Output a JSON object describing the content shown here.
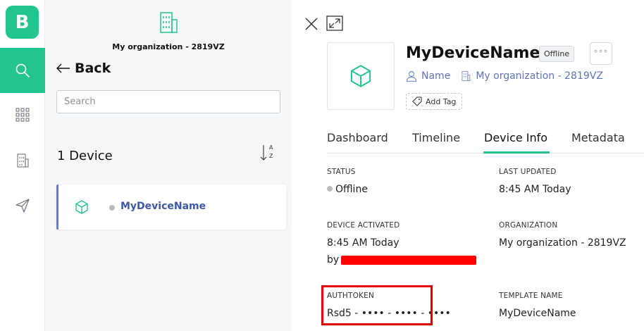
{
  "app": {
    "logo_letter": "B",
    "brand_color": "#23c48e"
  },
  "rail": {
    "items": [
      {
        "name": "search-icon",
        "active": true
      },
      {
        "name": "apps-grid-icon",
        "active": false
      },
      {
        "name": "building-icon",
        "active": false
      },
      {
        "name": "send-icon",
        "active": false
      }
    ]
  },
  "panel": {
    "org_name": "My organization - 2819VZ",
    "back_label": "Back",
    "search_placeholder": "Search",
    "device_count": "1 Device",
    "sort_label_top": "A",
    "sort_label_bottom": "Z",
    "devices": [
      {
        "name": "MyDeviceName",
        "status": "offline"
      }
    ]
  },
  "detail": {
    "title": "MyDeviceName",
    "status_badge": "Offline",
    "more_label": "°°°",
    "owner_label": "Name",
    "org_label": "My organization - 2819VZ",
    "add_tag_label": "Add Tag",
    "tabs": [
      "Dashboard",
      "Timeline",
      "Device Info",
      "Metadata"
    ],
    "active_tab": "Device Info",
    "fields": {
      "status_label": "STATUS",
      "status_value": "Offline",
      "last_updated_label": "LAST UPDATED",
      "last_updated_value": "8:45 AM Today",
      "device_activated_label": "DEVICE ACTIVATED",
      "device_activated_value": "8:45 AM Today",
      "device_activated_by": "by",
      "organization_label": "ORGANIZATION",
      "organization_value": "My organization - 2819VZ",
      "authtoken_label": "AUTHTOKEN",
      "authtoken_value": "Rsd5 - •••• - •••• - ••••",
      "template_name_label": "TEMPLATE NAME",
      "template_name_value": "MyDeviceName"
    }
  }
}
